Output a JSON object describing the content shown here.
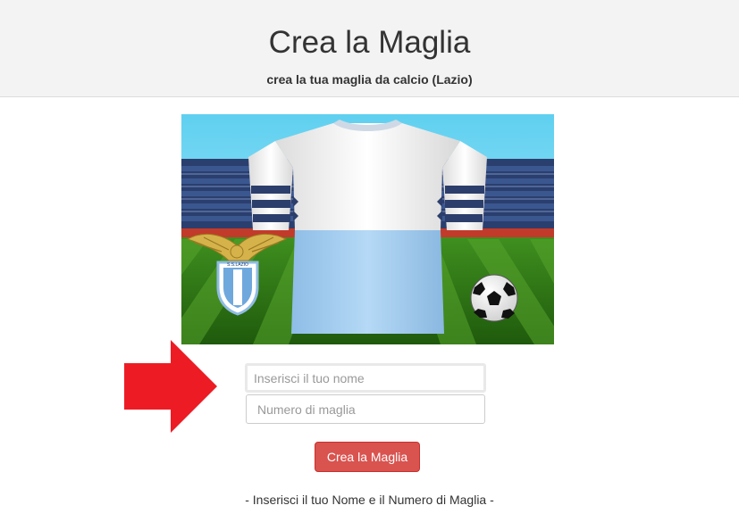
{
  "header": {
    "title": "Crea la Maglia",
    "subtitle": "crea la tua maglia da calcio (Lazio)"
  },
  "banner": {
    "logo_text": "S.S.LAZIO"
  },
  "form": {
    "name_placeholder": "Inserisci il tuo nome",
    "name_value": "",
    "number_placeholder": "Numero di maglia",
    "number_value": "",
    "submit_label": "Crea la Maglia"
  },
  "footer": {
    "note": "- Inserisci il tuo Nome e il Numero di Maglia -"
  },
  "colors": {
    "header_bg": "#f3f3f3",
    "button": "#d9534f",
    "arrow": "#ed1c24",
    "jersey_top": "#ffffff",
    "jersey_bottom": "#a6cff2",
    "stripe": "#2c3e6b"
  }
}
